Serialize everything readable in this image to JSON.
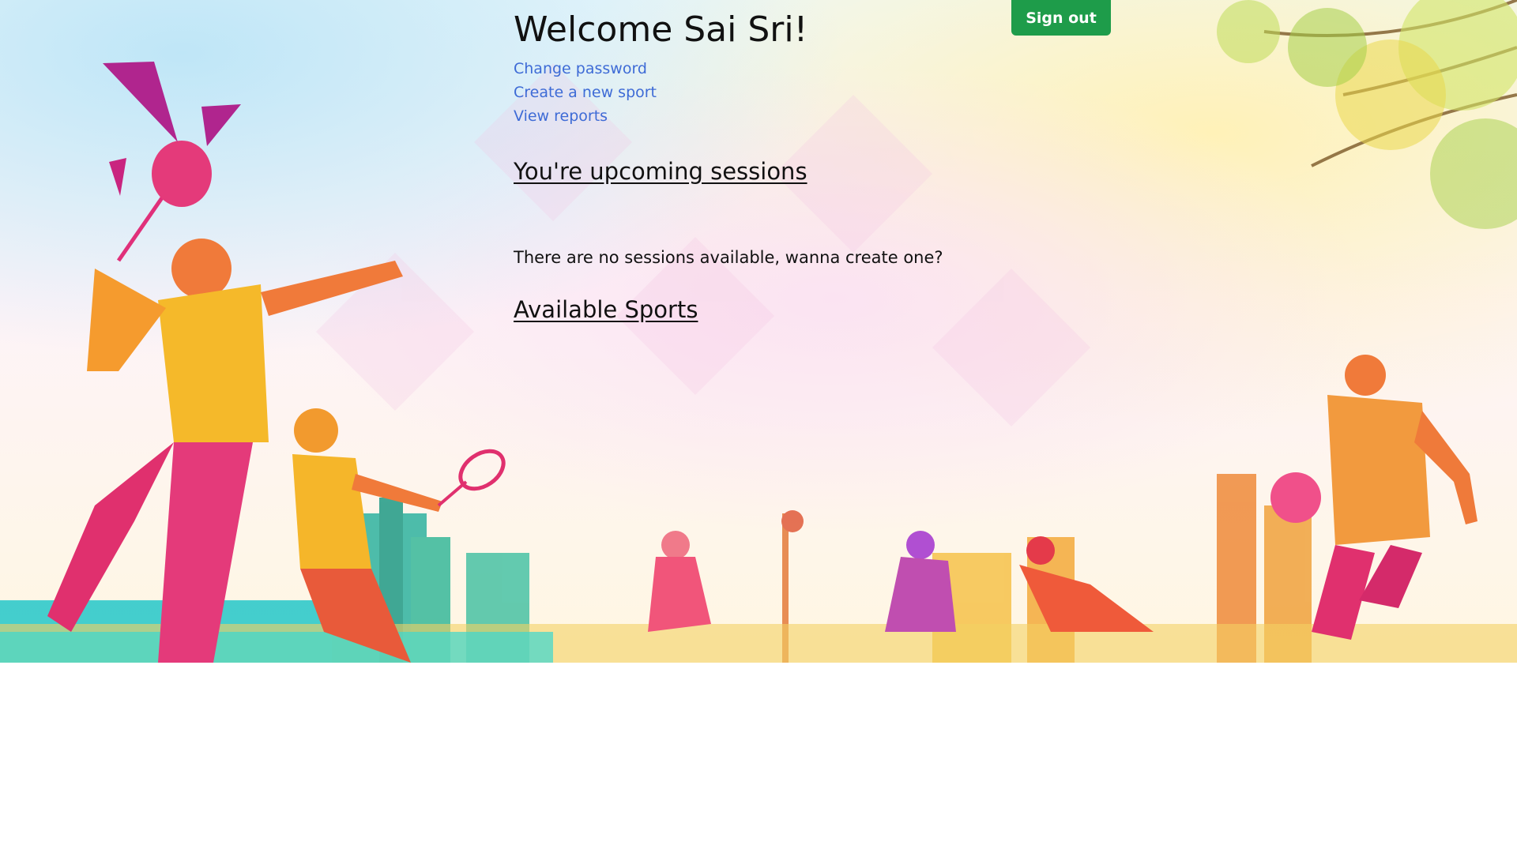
{
  "header": {
    "welcome_text": "Welcome Sai Sri!",
    "signout_label": "Sign out"
  },
  "nav_links": [
    {
      "label": "Change password"
    },
    {
      "label": "Create a new sport"
    },
    {
      "label": "View reports"
    }
  ],
  "sessions": {
    "heading": "You're upcoming sessions",
    "empty_message": "There are no sessions available, wanna create one?"
  },
  "sports": {
    "heading": "Available Sports"
  },
  "colors": {
    "link": "#3e6bd6",
    "signout_button": "#1e9c4a",
    "text": "#111111"
  },
  "banner_icon": "sports-silhouette-illustration"
}
